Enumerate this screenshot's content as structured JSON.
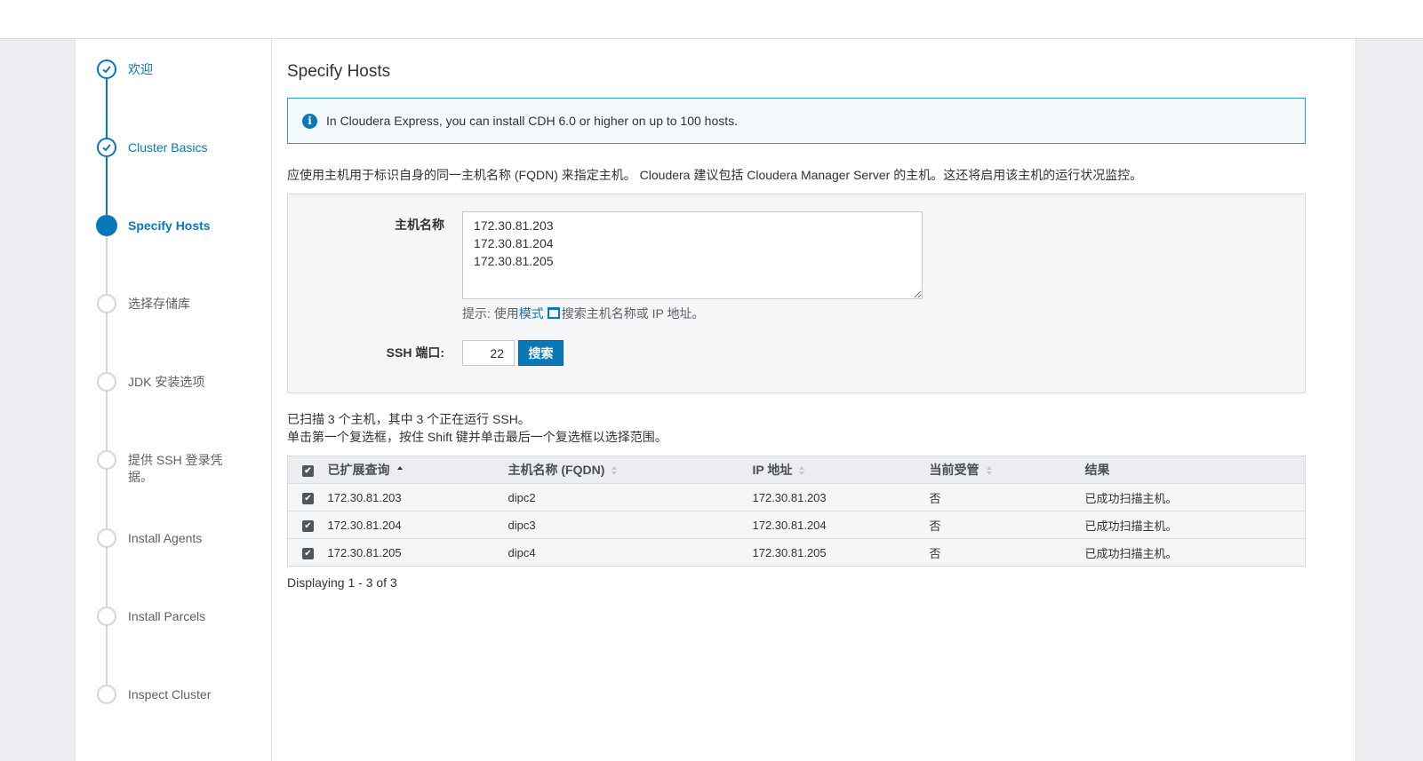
{
  "colors": {
    "accent": "#0779b8",
    "info_border": "#2aa1d2",
    "info_bg": "#f3f9fc"
  },
  "steps": [
    {
      "label": "欢迎",
      "state": "done"
    },
    {
      "label": "Cluster Basics",
      "state": "done"
    },
    {
      "label": "Specify Hosts",
      "state": "active"
    },
    {
      "label": "选择存储库",
      "state": "pending"
    },
    {
      "label": "JDK 安装选项",
      "state": "pending"
    },
    {
      "label": "提供 SSH 登录凭据。",
      "state": "pending"
    },
    {
      "label": "Install Agents",
      "state": "pending"
    },
    {
      "label": "Install Parcels",
      "state": "pending"
    },
    {
      "label": "Inspect Cluster",
      "state": "pending"
    }
  ],
  "page": {
    "title": "Specify Hosts",
    "info_icon": "info-icon",
    "info_text": "In Cloudera Express, you can install CDH 6.0 or higher on up to 100 hosts.",
    "description": "应使用主机用于标识自身的同一主机名称 (FQDN) 来指定主机。 Cloudera 建议包括 Cloudera Manager Server 的主机。这还将启用该主机的运行状况监控。"
  },
  "form": {
    "hostname_label": "主机名称",
    "hostnames_value": "172.30.81.203\n172.30.81.204\n172.30.81.205",
    "hint_prefix": "提示: 使用",
    "hint_link": "模式",
    "hint_suffix": "搜索主机名称或 IP 地址。",
    "ssh_port_label": "SSH 端口:",
    "ssh_port_value": "22",
    "search_button": "搜索"
  },
  "summary": {
    "line1": "已扫描 3 个主机，其中 3 个正在运行 SSH。",
    "line2": "单击第一个复选框，按住 Shift 键并单击最后一个复选框以选择范围。"
  },
  "table": {
    "columns": [
      "已扩展查询",
      "主机名称 (FQDN)",
      "IP 地址",
      "当前受管",
      "结果"
    ],
    "rows": [
      {
        "checked": true,
        "expanded_query": "172.30.81.203",
        "hostname": "dipc2",
        "ip": "172.30.81.203",
        "managed": "否",
        "result": "已成功扫描主机。"
      },
      {
        "checked": true,
        "expanded_query": "172.30.81.204",
        "hostname": "dipc3",
        "ip": "172.30.81.204",
        "managed": "否",
        "result": "已成功扫描主机。"
      },
      {
        "checked": true,
        "expanded_query": "172.30.81.205",
        "hostname": "dipc4",
        "ip": "172.30.81.205",
        "managed": "否",
        "result": "已成功扫描主机。"
      }
    ],
    "displaying": "Displaying 1 - 3 of 3"
  }
}
